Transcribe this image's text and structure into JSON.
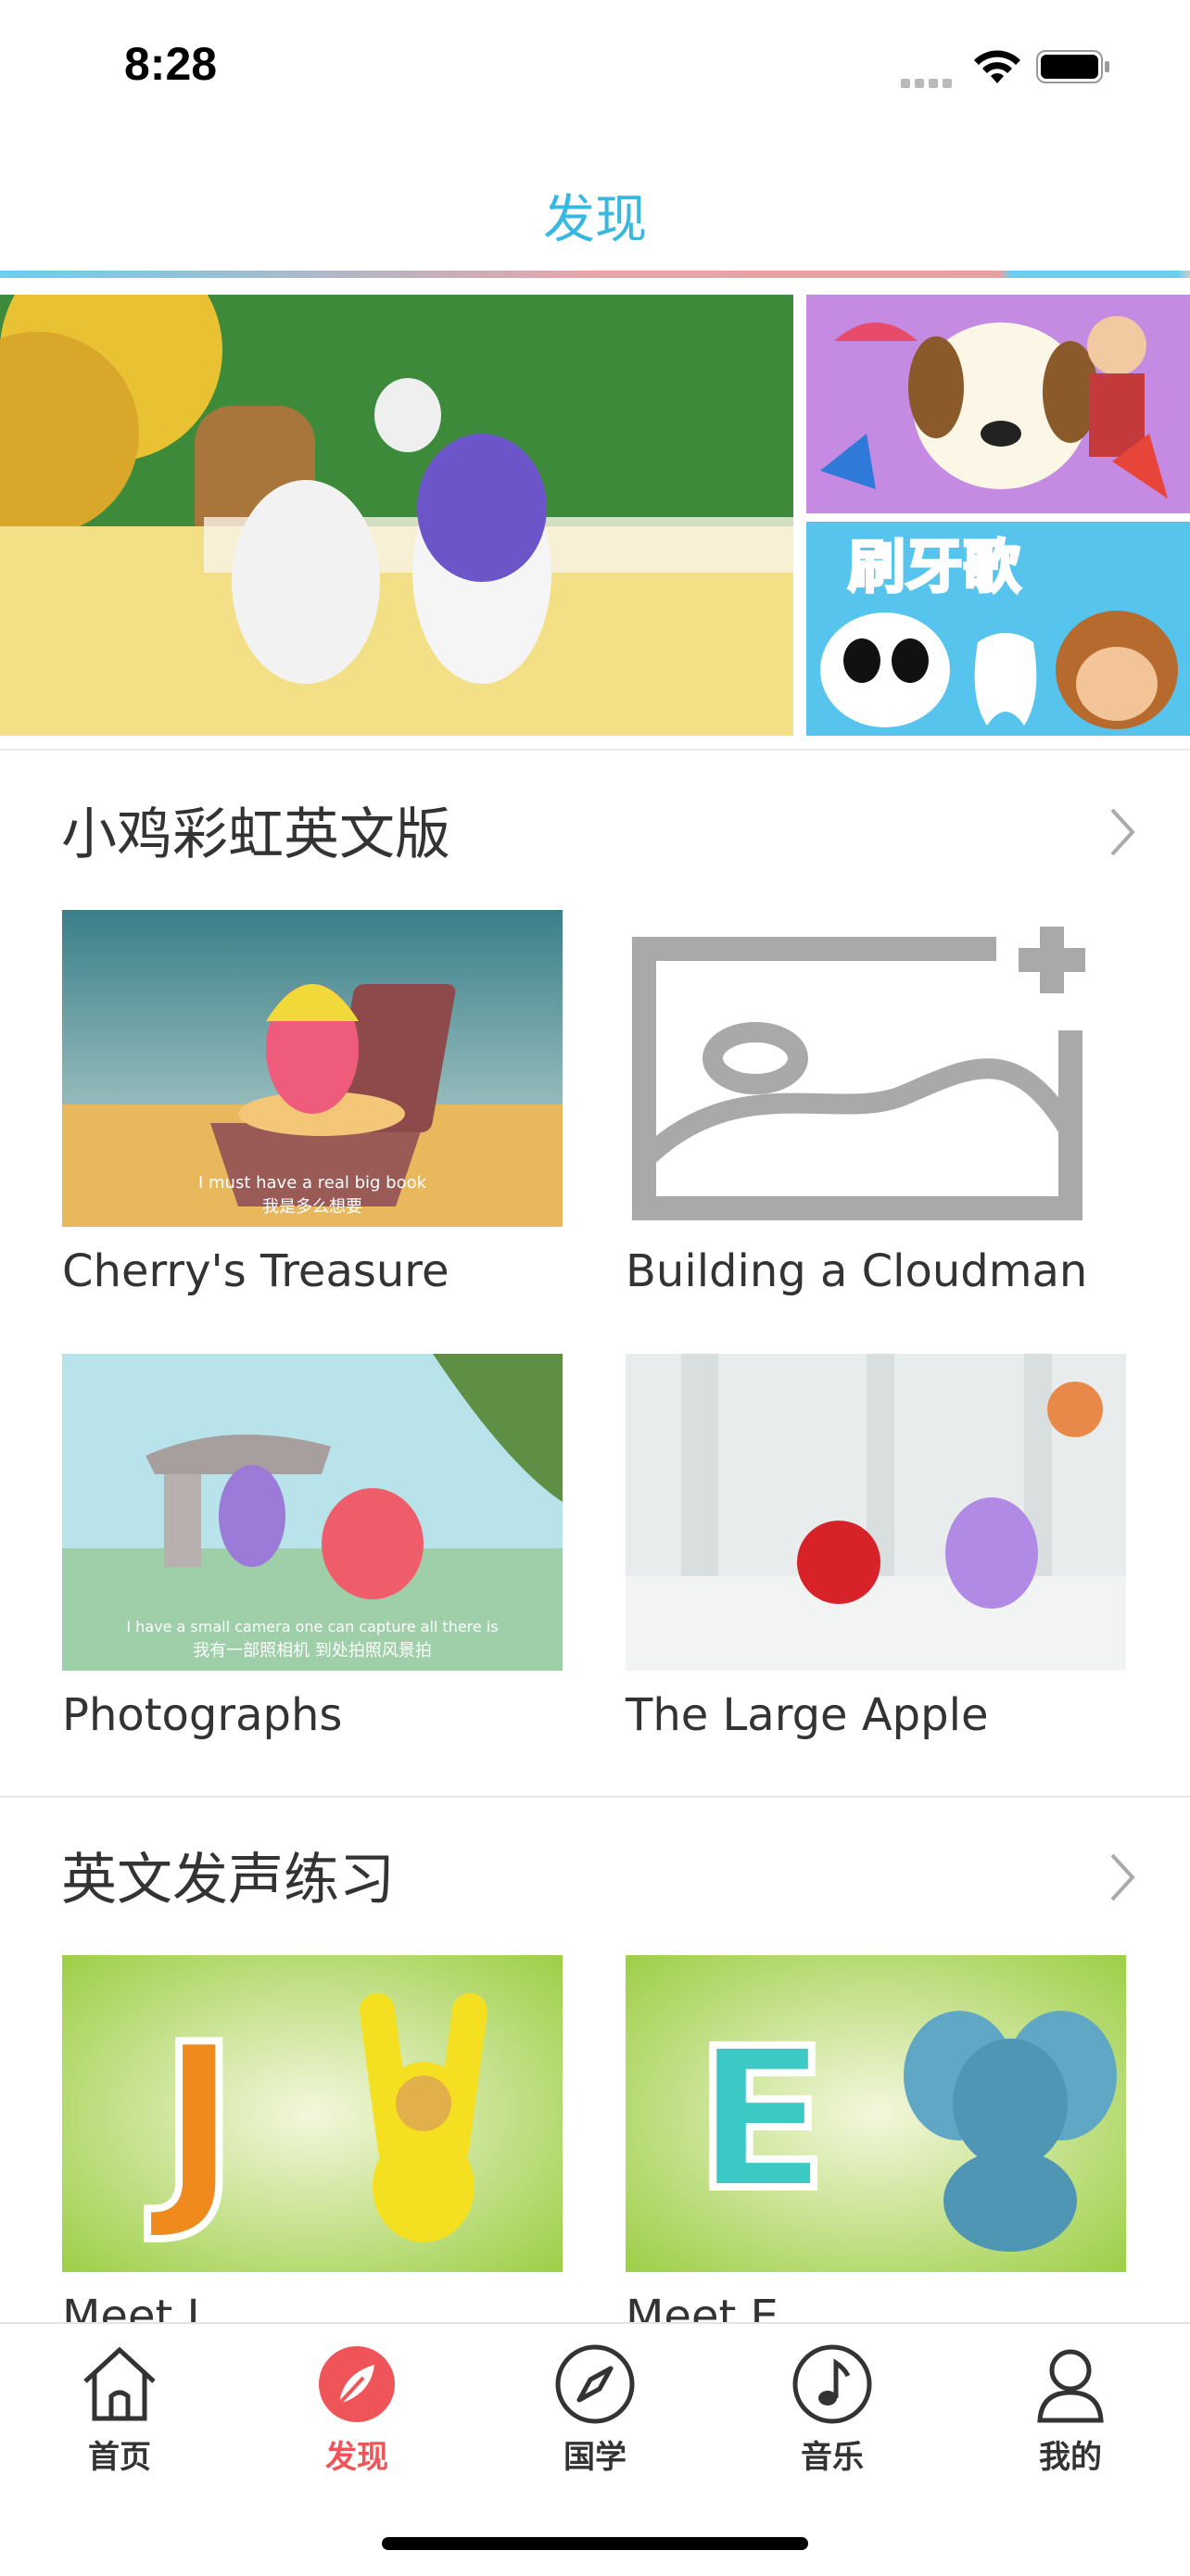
{
  "status": {
    "time": "8:28"
  },
  "nav": {
    "title": "发现"
  },
  "sections": [
    {
      "title": "小鸡彩虹英文版",
      "items": [
        {
          "title": "Cherry's Treasure",
          "subtitle_en": "I must have a real big book",
          "subtitle_zh": "我是多么想要"
        },
        {
          "title": "Building a Cloudman"
        },
        {
          "title": "Photographs",
          "subtitle_en": "I have a small camera one can capture all there is",
          "subtitle_zh": "我有一部照相机 到处拍照风景拍"
        },
        {
          "title": "The Large Apple"
        }
      ]
    },
    {
      "title": "英文发声练习",
      "items": [
        {
          "title": "Meet J",
          "letter": "J"
        },
        {
          "title": "Meet E",
          "letter": "E"
        }
      ]
    }
  ],
  "banner": {
    "r2_text": "刷牙歌"
  },
  "tabs": [
    {
      "label": "首页",
      "icon": "home-icon"
    },
    {
      "label": "发现",
      "icon": "compass-leaf-icon"
    },
    {
      "label": "国学",
      "icon": "compass-icon"
    },
    {
      "label": "音乐",
      "icon": "music-note-icon"
    },
    {
      "label": "我的",
      "icon": "user-icon"
    }
  ],
  "colors": {
    "accent": "#38b8e0",
    "active_tab": "#ef5459"
  }
}
